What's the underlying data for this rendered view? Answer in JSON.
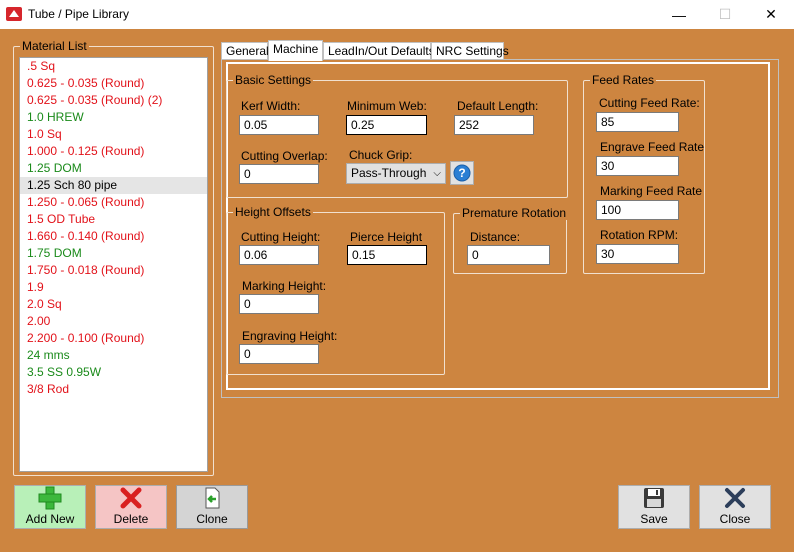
{
  "window": {
    "title": "Tube / Pipe Library",
    "minimize_glyph": "—",
    "maximize_glyph": "☐",
    "close_glyph": "✕"
  },
  "material_list": {
    "legend": "Material List",
    "items": [
      {
        "label": ".5 Sq",
        "color": "red"
      },
      {
        "label": "0.625 - 0.035 (Round)",
        "color": "red"
      },
      {
        "label": "0.625 - 0.035 (Round) (2)",
        "color": "red"
      },
      {
        "label": "1.0 HREW",
        "color": "green"
      },
      {
        "label": "1.0 Sq",
        "color": "red"
      },
      {
        "label": "1.000 - 0.125 (Round)",
        "color": "red"
      },
      {
        "label": "1.25 DOM",
        "color": "green"
      },
      {
        "label": "1.25 Sch 80 pipe",
        "color": "black",
        "selected": true
      },
      {
        "label": "1.250 - 0.065 (Round)",
        "color": "red"
      },
      {
        "label": "1.5 OD Tube",
        "color": "red"
      },
      {
        "label": "1.660 - 0.140 (Round)",
        "color": "red"
      },
      {
        "label": "1.75 DOM",
        "color": "green"
      },
      {
        "label": "1.750 - 0.018 (Round)",
        "color": "red"
      },
      {
        "label": "1.9",
        "color": "red"
      },
      {
        "label": "2.0 Sq",
        "color": "red"
      },
      {
        "label": "2.00",
        "color": "red"
      },
      {
        "label": "2.200 - 0.100 (Round)",
        "color": "red"
      },
      {
        "label": "24 mms",
        "color": "green"
      },
      {
        "label": "3.5 SS 0.95W",
        "color": "green"
      },
      {
        "label": "3/8 Rod",
        "color": "red"
      }
    ]
  },
  "tabs": [
    {
      "label": "General",
      "active": false
    },
    {
      "label": "Machine",
      "active": true
    },
    {
      "label": "LeadIn/Out Defaults",
      "active": false
    },
    {
      "label": "NRC Settings",
      "active": false
    }
  ],
  "basic_settings": {
    "legend": "Basic Settings",
    "kerf_width_label": "Kerf Width:",
    "kerf_width_value": "0.05",
    "minimum_web_label": "Minimum Web:",
    "minimum_web_value": "0.25",
    "default_length_label": "Default Length:",
    "default_length_value": "252",
    "cutting_overlap_label": "Cutting Overlap:",
    "cutting_overlap_value": "0",
    "chuck_grip_label": "Chuck Grip:",
    "chuck_grip_value": "Pass-Through"
  },
  "height_offsets": {
    "legend": "Height Offsets",
    "cutting_height_label": "Cutting Height:",
    "cutting_height_value": "0.06",
    "pierce_height_label": "Pierce Height",
    "pierce_height_value": "0.15",
    "marking_height_label": "Marking Height:",
    "marking_height_value": "0",
    "engraving_height_label": "Engraving Height:",
    "engraving_height_value": "0"
  },
  "premature_rotation": {
    "legend": "Premature Rotation",
    "distance_label": "Distance:",
    "distance_value": "0"
  },
  "feed_rates": {
    "legend": "Feed Rates",
    "cutting_label": "Cutting Feed Rate:",
    "cutting_value": "85",
    "engrave_label": "Engrave Feed Rate",
    "engrave_value": "30",
    "marking_label": "Marking Feed Rate",
    "marking_value": "100",
    "rotation_label": "Rotation RPM:",
    "rotation_value": "30"
  },
  "buttons": {
    "add_new": "Add New",
    "delete": "Delete",
    "clone": "Clone",
    "save": "Save",
    "close": "Close"
  },
  "colors": {
    "background": "#cd8540",
    "list_red": "#e2121a",
    "list_green": "#1a8a1a",
    "add_button_bg": "#b8f0b8",
    "delete_button_bg": "#f5c5c5",
    "help_blue": "#2a7fd4"
  },
  "icons": {
    "add": "plus-icon",
    "delete": "x-icon",
    "clone": "document-arrow-icon",
    "save": "floppy-disk-icon",
    "close": "x-icon",
    "help": "question-icon",
    "app": "app-icon"
  }
}
